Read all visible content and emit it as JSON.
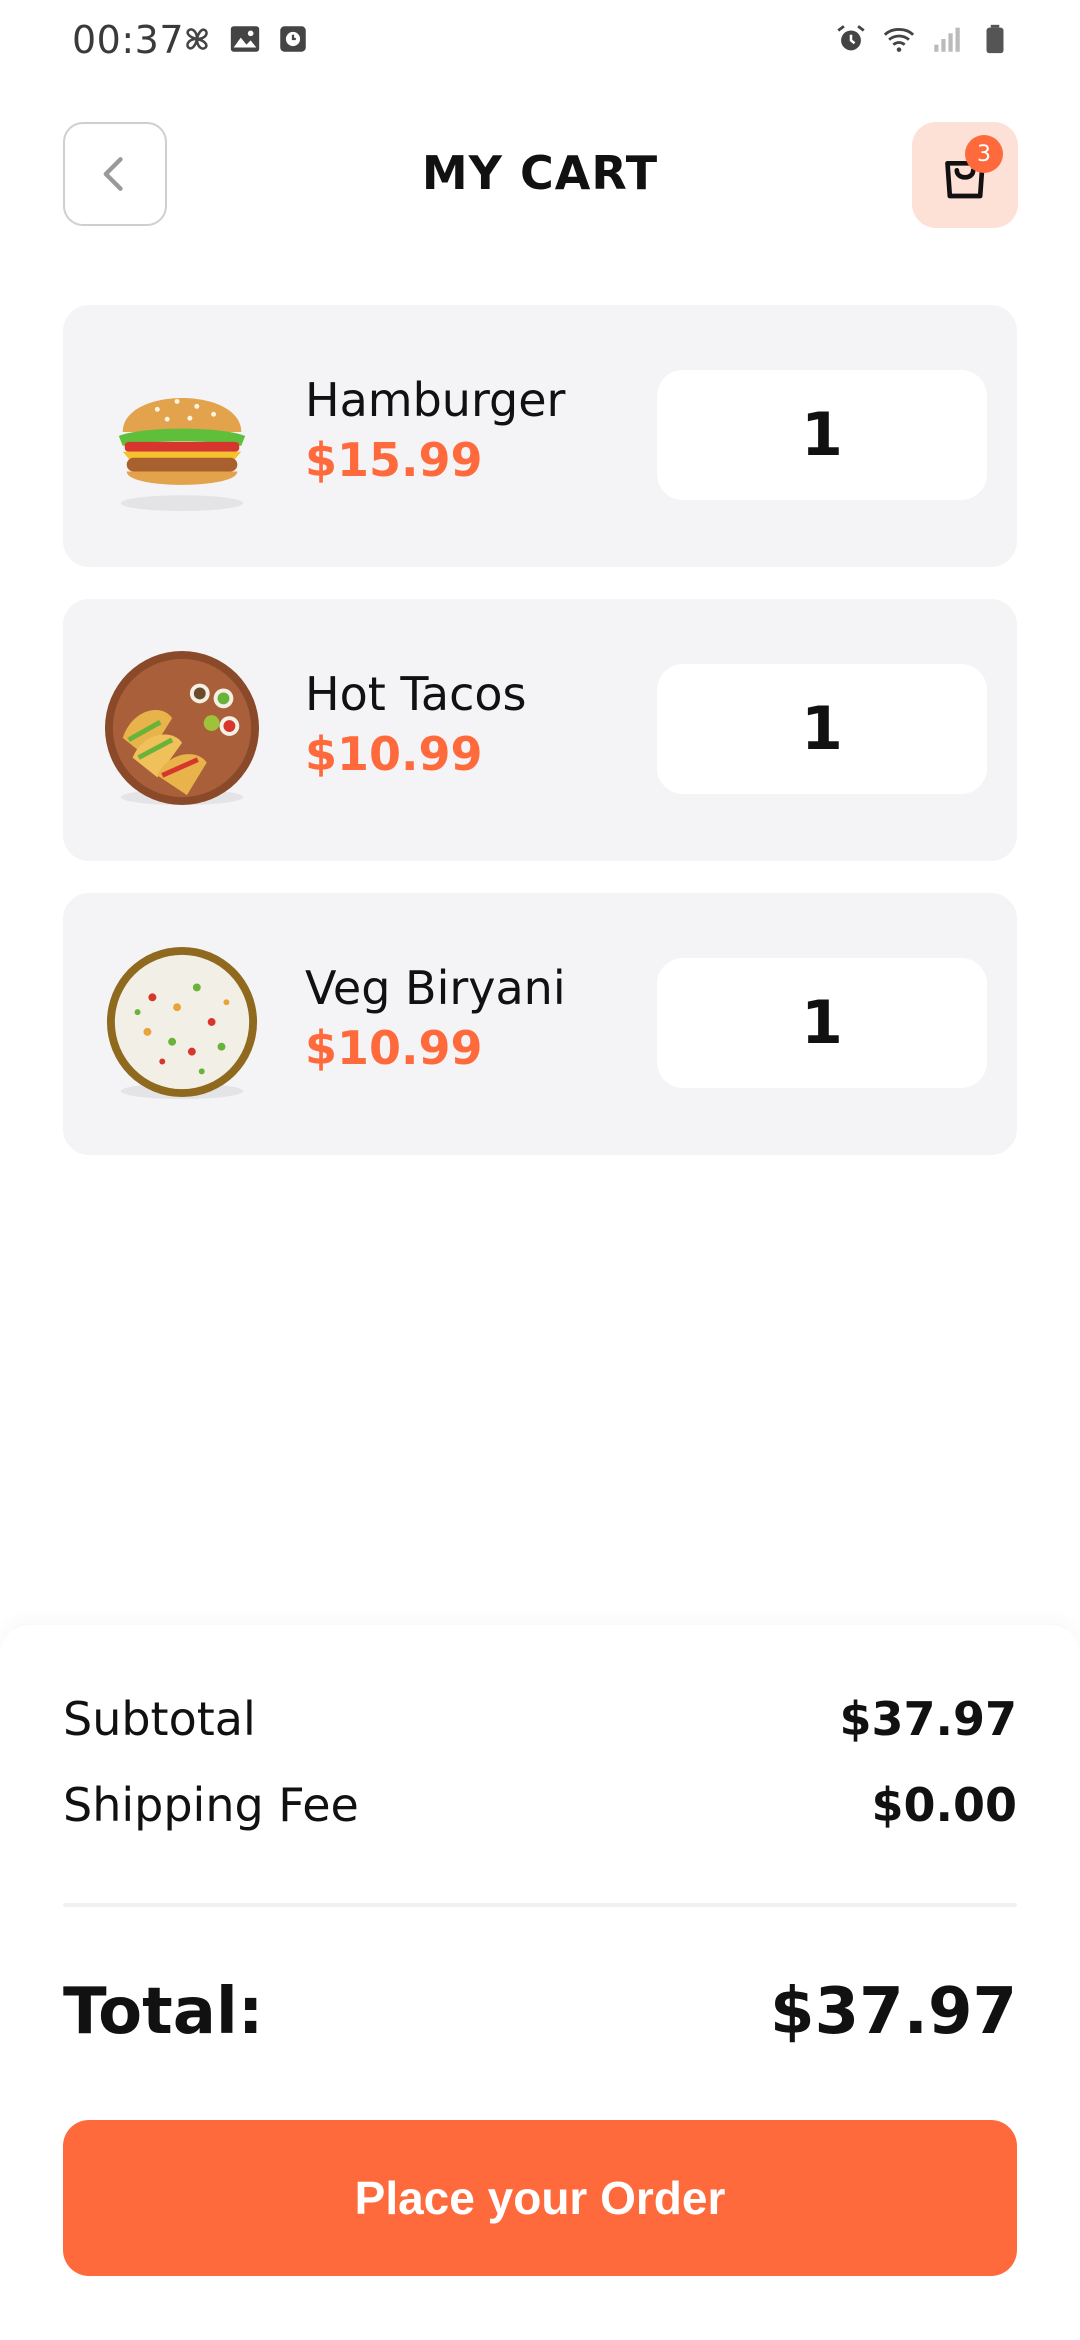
{
  "status_bar": {
    "time": "00:37",
    "left_icons": [
      "pinwheel-icon",
      "image-icon",
      "clock-square-icon"
    ],
    "right_icons": [
      "alarm-icon",
      "wifi-icon",
      "signal-icon",
      "battery-icon"
    ]
  },
  "header": {
    "title": "MY CART",
    "back_icon": "chevron-left-icon",
    "cart_icon": "shopping-bag-icon",
    "cart_badge": "3"
  },
  "cart_items": [
    {
      "name": "Hamburger",
      "price": "$15.99",
      "quantity": "1",
      "image": "hamburger-image"
    },
    {
      "name": "Hot Tacos",
      "price": "$10.99",
      "quantity": "1",
      "image": "tacos-image"
    },
    {
      "name": "Veg Biryani",
      "price": "$10.99",
      "quantity": "1",
      "image": "biryani-image"
    }
  ],
  "summary": {
    "subtotal_label": "Subtotal",
    "subtotal_value": "$37.97",
    "shipping_label": "Shipping Fee",
    "shipping_value": "$0.00",
    "total_label": "Total:",
    "total_value": "$37.97"
  },
  "actions": {
    "place_order_label": "Place your Order"
  },
  "colors": {
    "accent": "#ff6a3d",
    "card_background": "#f4f4f6",
    "cart_button_background": "#fde0d6"
  }
}
